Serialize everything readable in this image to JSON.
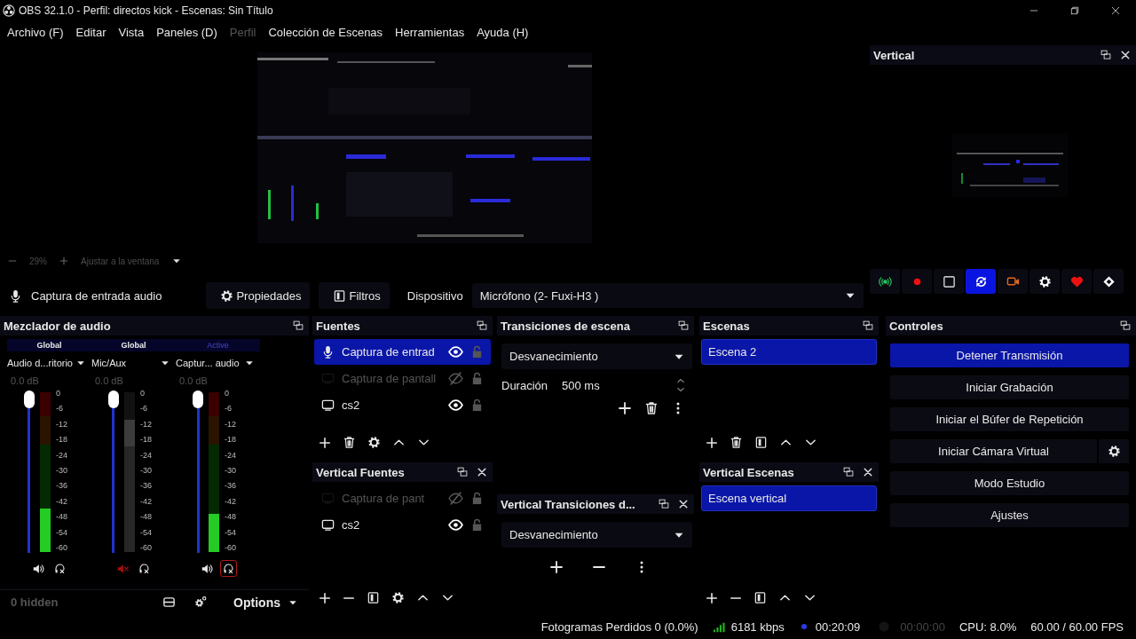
{
  "window": {
    "title": "OBS 32.1.0 - Perfil: directos kick - Escenas: Sin Título"
  },
  "menu": [
    {
      "label": "Archivo (F)",
      "disabled": false
    },
    {
      "label": "Editar",
      "disabled": false
    },
    {
      "label": "Vista",
      "disabled": false
    },
    {
      "label": "Paneles (D)",
      "disabled": false
    },
    {
      "label": "Perfil",
      "disabled": true
    },
    {
      "label": "Colección de Escenas",
      "disabled": false
    },
    {
      "label": "Herramientas",
      "disabled": false
    },
    {
      "label": "Ayuda (H)",
      "disabled": false
    }
  ],
  "preview": {
    "zoom": "29%",
    "fit": "Ajustar a la ventana"
  },
  "vertical_preview": {
    "title": "Vertical"
  },
  "quick_buttons": [
    {
      "kind": "stream",
      "selected": false
    },
    {
      "kind": "record",
      "selected": false
    },
    {
      "kind": "stop",
      "selected": false
    },
    {
      "kind": "replay",
      "selected": true
    },
    {
      "kind": "camera",
      "selected": false
    },
    {
      "kind": "settings",
      "selected": false
    },
    {
      "kind": "heart",
      "selected": false
    },
    {
      "kind": "exit",
      "selected": false
    }
  ],
  "source_bar": {
    "source": "Captura de entrada audio",
    "properties_button": "Propiedades",
    "filters_button": "Filtros",
    "device_label": "Dispositivo",
    "device": "Micrófono (2- Fuxi-H3 )"
  },
  "mixer": {
    "title": "Mezclador de audio",
    "channels": [
      {
        "scope": "Global",
        "scope_active": false,
        "name": "Audio d...ritorio",
        "db": "0.0 dB",
        "volume": {
          "level": 1
        },
        "meter": {
          "level": 0.27
        },
        "muted": false,
        "monitor_highlighted": false,
        "scale": [
          "0",
          "-6",
          "-12",
          "-18",
          "-24",
          "-30",
          "-36",
          "-42",
          "-48",
          "-54",
          "-60"
        ]
      },
      {
        "scope": "Global",
        "scope_active": false,
        "name": "Mic/Aux",
        "db": "0.0 dB",
        "volume": {
          "level": 1
        },
        "meter": {
          "level": 0.83
        },
        "muted": true,
        "monitor_highlighted": false,
        "scale": [
          "0",
          "-6",
          "-12",
          "-18",
          "-24",
          "-30",
          "-36",
          "-42",
          "-48",
          "-54",
          "-60"
        ]
      },
      {
        "scope": "Active",
        "scope_active": true,
        "name": "Captur... audio",
        "db": "0.0 dB",
        "volume": {
          "level": 1
        },
        "meter": {
          "level": 0.24
        },
        "muted": false,
        "monitor_highlighted": true,
        "scale": [
          "0",
          "-6",
          "-12",
          "-18",
          "-24",
          "-30",
          "-36",
          "-42",
          "-48",
          "-54",
          "-60"
        ]
      }
    ],
    "hidden_count": "0 hidden",
    "options_button": "Options"
  },
  "sources": {
    "title": "Fuentes",
    "items": [
      {
        "kind": "mic",
        "name": "Captura de entrad",
        "selected": true,
        "visible": true,
        "locked": false
      },
      {
        "kind": "display",
        "name": "Captura de pantall",
        "selected": false,
        "visible": false,
        "locked": false
      },
      {
        "kind": "display",
        "name": "cs2",
        "selected": false,
        "visible": true,
        "locked": false
      }
    ]
  },
  "vertical_sources": {
    "title": "Vertical Fuentes",
    "items": [
      {
        "kind": "display",
        "name": "Captura de pant",
        "selected": false,
        "visible": false,
        "locked": false
      },
      {
        "kind": "display",
        "name": "cs2",
        "selected": false,
        "visible": true,
        "locked": false
      }
    ]
  },
  "transitions": {
    "title": "Transiciones de escena",
    "transition": "Desvanecimiento",
    "duration_label": "Duración",
    "duration": "500 ms"
  },
  "vertical_transitions": {
    "title": "Vertical Transiciones d...",
    "transition": "Desvanecimiento"
  },
  "scenes": {
    "title": "Escenas",
    "items": [
      {
        "name": "Escena 2",
        "selected": true
      }
    ]
  },
  "vertical_scenes": {
    "title": "Vertical Escenas",
    "items": [
      {
        "name": "Escena vertical",
        "selected": true
      }
    ]
  },
  "controls": {
    "title": "Controles",
    "buttons": [
      {
        "label": "Detener Transmisión",
        "active": true,
        "settings": false
      },
      {
        "label": "Iniciar Grabación",
        "active": false,
        "settings": false
      },
      {
        "label": "Iniciar el Búfer de Repetición",
        "active": false,
        "settings": false
      },
      {
        "label": "Iniciar Cámara Virtual",
        "active": false,
        "settings": true
      },
      {
        "label": "Modo Estudio",
        "active": false,
        "settings": false
      },
      {
        "label": "Ajustes",
        "active": false,
        "settings": false
      }
    ]
  },
  "status_bar": {
    "dropped_frames": "Fotogramas Perdidos 0 (0.0%)",
    "bitrate": "6181 kbps",
    "stream_time": "00:20:09",
    "streaming": true,
    "record_time": "00:00:00",
    "recording": false,
    "cpu": "CPU: 8.0%",
    "fps": "60.00 / 60.00 FPS"
  }
}
